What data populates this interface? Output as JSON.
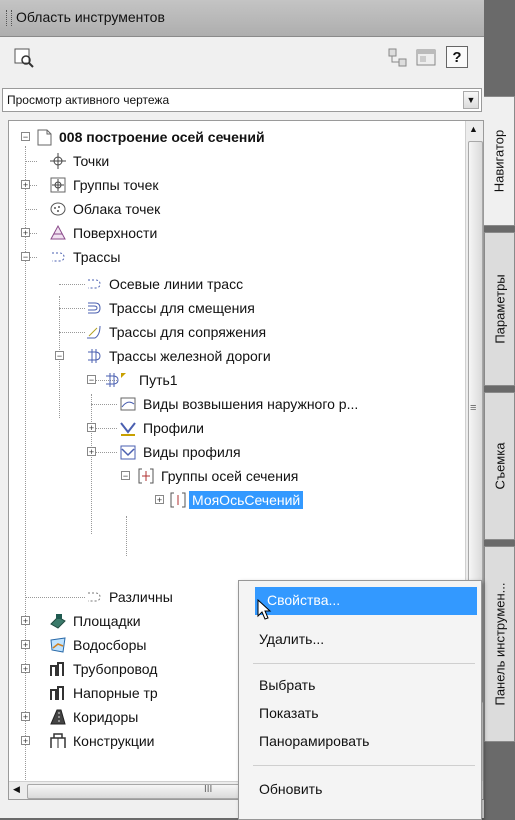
{
  "window": {
    "title": "Область инструментов"
  },
  "toolbar": {
    "icons": [
      "preview-icon",
      "tree-icon",
      "window-icon",
      "help-icon"
    ],
    "help_label": "?"
  },
  "view_dropdown": {
    "selected": "Просмотр активного чертежа",
    "arrow": "▼"
  },
  "tree": {
    "root": "008 построение осей сечений",
    "points": "Точки",
    "point_groups": "Группы точек",
    "point_clouds": "Облака точек",
    "surfaces": "Поверхности",
    "alignments": "Трассы",
    "centerline_alignments": "Осевые линии трасс",
    "offset_alignments": "Трассы для смещения",
    "curb_return_alignments": "Трассы для сопряжения",
    "rail_alignments": "Трассы железной дороги",
    "track": "Путь1",
    "views_elevation": "Виды возвышения наружного р...",
    "profiles": "Профили",
    "profile_views": "Виды профиля",
    "sample_line_groups": "Группы осей сечения",
    "selected_item": "МояОсьСечений",
    "misc": "Различны",
    "sites": "Площадки",
    "catchments": "Водосборы",
    "pipe_networks": "Трубопровод",
    "pressure_networks": "Напорные тр",
    "corridors": "Коридоры",
    "structures": "Конструкции",
    "expand_symbol": "+",
    "collapse_symbol": "−",
    "scroll_h_grip": "III",
    "scroll_v_grip": "≡"
  },
  "side_tabs": [
    "Навигатор",
    "Параметры",
    "Съемка",
    "Панель инструмен..."
  ],
  "context_menu": {
    "properties": "Свойства...",
    "delete": "Удалить...",
    "select": "Выбрать",
    "show": "Показать",
    "pan": "Панорамировать",
    "refresh": "Обновить"
  },
  "colors": {
    "selection": "#3399ff",
    "titlebar": "#b8b8b8",
    "background": "#6a6a6a"
  }
}
